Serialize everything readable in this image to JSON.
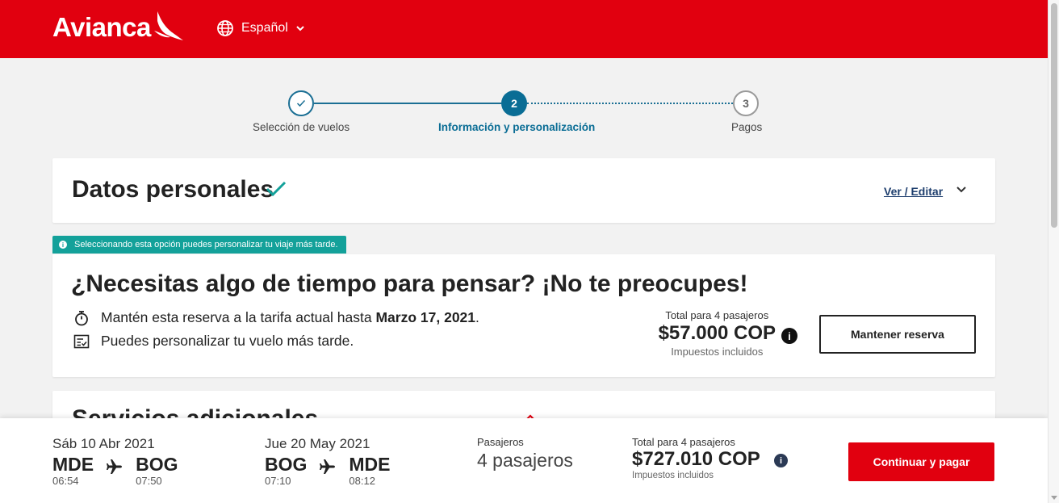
{
  "header": {
    "brand": "Avianca",
    "language": "Español",
    "colors": {
      "brand_red": "#e1000f",
      "accent_blue": "#0a6d95",
      "teal": "#13a19a"
    }
  },
  "stepper": {
    "steps": [
      {
        "number": "✓",
        "label": "Selección de vuelos",
        "state": "done"
      },
      {
        "number": "2",
        "label": "Información y personalización",
        "state": "active"
      },
      {
        "number": "3",
        "label": "Pagos",
        "state": "pending"
      }
    ]
  },
  "datos": {
    "title": "Datos personales",
    "edit_label": "Ver / Editar"
  },
  "badge": {
    "text": "Seleccionando esta opción puedes personalizar tu viaje más tarde."
  },
  "hold": {
    "headline": "¿Necesitas algo de tiempo para pensar? ¡No te preocupes!",
    "line1_prefix": "Mantén esta reserva a la tarifa actual hasta ",
    "line1_date": "Marzo 17, 2021",
    "line1_suffix": ".",
    "line2": "Puedes personalizar tu vuelo más tarde.",
    "total_label": "Total para 4 pasajeros",
    "amount": "$57.000 COP",
    "tax_label": "Impuestos incluidos",
    "button_label": "Mantener reserva"
  },
  "servicios": {
    "title": "Servicios adicionales"
  },
  "footer": {
    "legs": [
      {
        "date": "Sáb 10 Abr 2021",
        "from": "MDE",
        "from_time": "06:54",
        "to": "BOG",
        "to_time": "07:50"
      },
      {
        "date": "Jue 20 May 2021",
        "from": "BOG",
        "from_time": "07:10",
        "to": "MDE",
        "to_time": "08:12"
      }
    ],
    "pax_label": "Pasajeros",
    "pax_value": "4 pasajeros",
    "total_label": "Total para 4 pasajeros",
    "total_amount": "$727.010 COP",
    "tax_label": "Impuestos incluidos",
    "pay_button": "Continuar y pagar"
  }
}
